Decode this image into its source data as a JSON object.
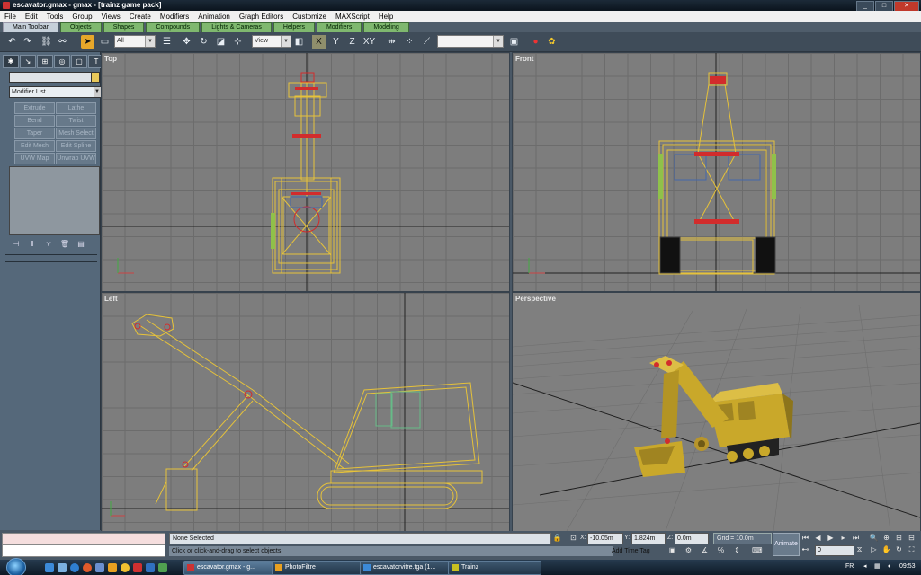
{
  "window": {
    "title": "escavator.gmax - gmax - [trainz game pack]"
  },
  "menu": [
    "File",
    "Edit",
    "Tools",
    "Group",
    "Views",
    "Create",
    "Modifiers",
    "Animation",
    "Graph Editors",
    "Customize",
    "MAXScript",
    "Help"
  ],
  "tabs": [
    "Main Toolbar",
    "Objects",
    "Shapes",
    "Compounds",
    "Lights & Cameras",
    "Helpers",
    "Modifiers",
    "Modeling"
  ],
  "toolbar": {
    "selection_filter": "All",
    "ref_coord": "View",
    "named_selection": ""
  },
  "command_panel": {
    "modifier_list": "Modifier List",
    "modifier_buttons": [
      "Extrude",
      "Lathe",
      "Bend",
      "Twist",
      "Taper",
      "Mesh Select",
      "Edit Mesh",
      "Edit Spline",
      "UVW Map",
      "Unwrap UVW"
    ]
  },
  "viewports": {
    "top": "Top",
    "front": "Front",
    "left": "Left",
    "perspective": "Perspective"
  },
  "status": {
    "selection": "None Selected",
    "prompt": "Click or click-and-drag to select objects",
    "x_label": "X:",
    "x_value": "-10.05m",
    "y_label": "Y:",
    "y_value": "1.824m",
    "z_label": "Z:",
    "z_value": "0.0m",
    "grid": "Grid = 10.0m",
    "add_time_tag": "Add Time Tag",
    "animate": "Animate",
    "frame": "0"
  },
  "taskbar": {
    "tasks": [
      "escavator.gmax - g...",
      "PhotoFiltre",
      "escavatorvitre.tga (1...",
      "Trainz"
    ],
    "lang": "FR",
    "clock": "09:53"
  },
  "colors": {
    "wire": "#e6c23a",
    "accent_red": "#d22c2c",
    "tab_green": "#7fb86f",
    "active_tool": "#e7a72a"
  }
}
